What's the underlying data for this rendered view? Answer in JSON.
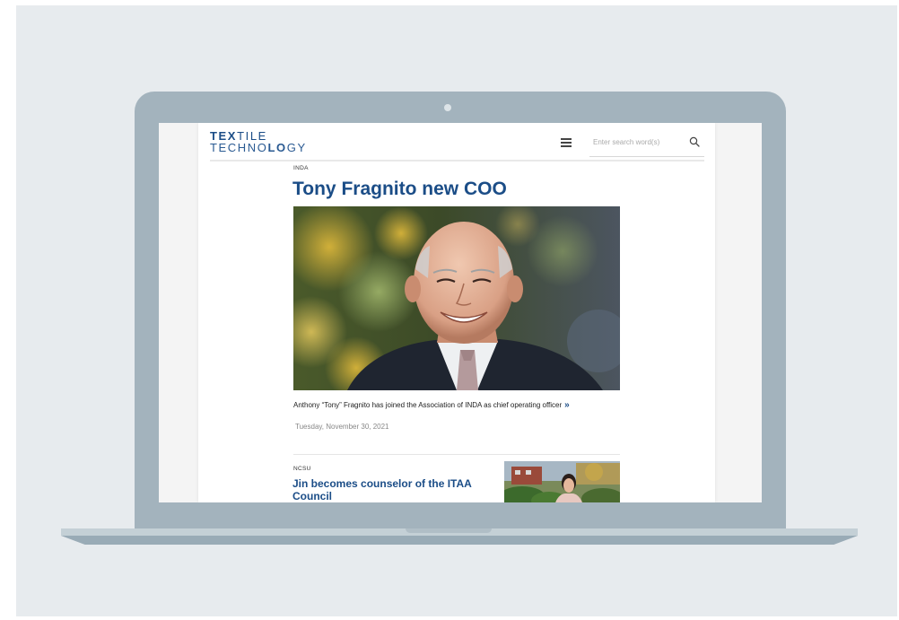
{
  "site": {
    "logo_line1": "TEXTILE",
    "logo_line2": "TECHNOLOGY"
  },
  "header": {
    "menu_icon": "hamburger-menu-icon",
    "search_placeholder": "Enter search word(s)",
    "search_icon": "magnifier-icon"
  },
  "articles": [
    {
      "tag": "INDA",
      "title": "Tony Fragnito new COO",
      "summary": "Anthony “Tony” Fragnito has joined the Association of INDA as chief operating officer",
      "more": "»",
      "date": "Tuesday, November 30, 2021"
    },
    {
      "tag": "NCSU",
      "title": "Jin becomes counselor of the ITAA Council"
    }
  ],
  "colors": {
    "brand_blue": "#1b4d87",
    "laptop_frame": "#a3b3bd",
    "backdrop": "#e7ebee"
  }
}
